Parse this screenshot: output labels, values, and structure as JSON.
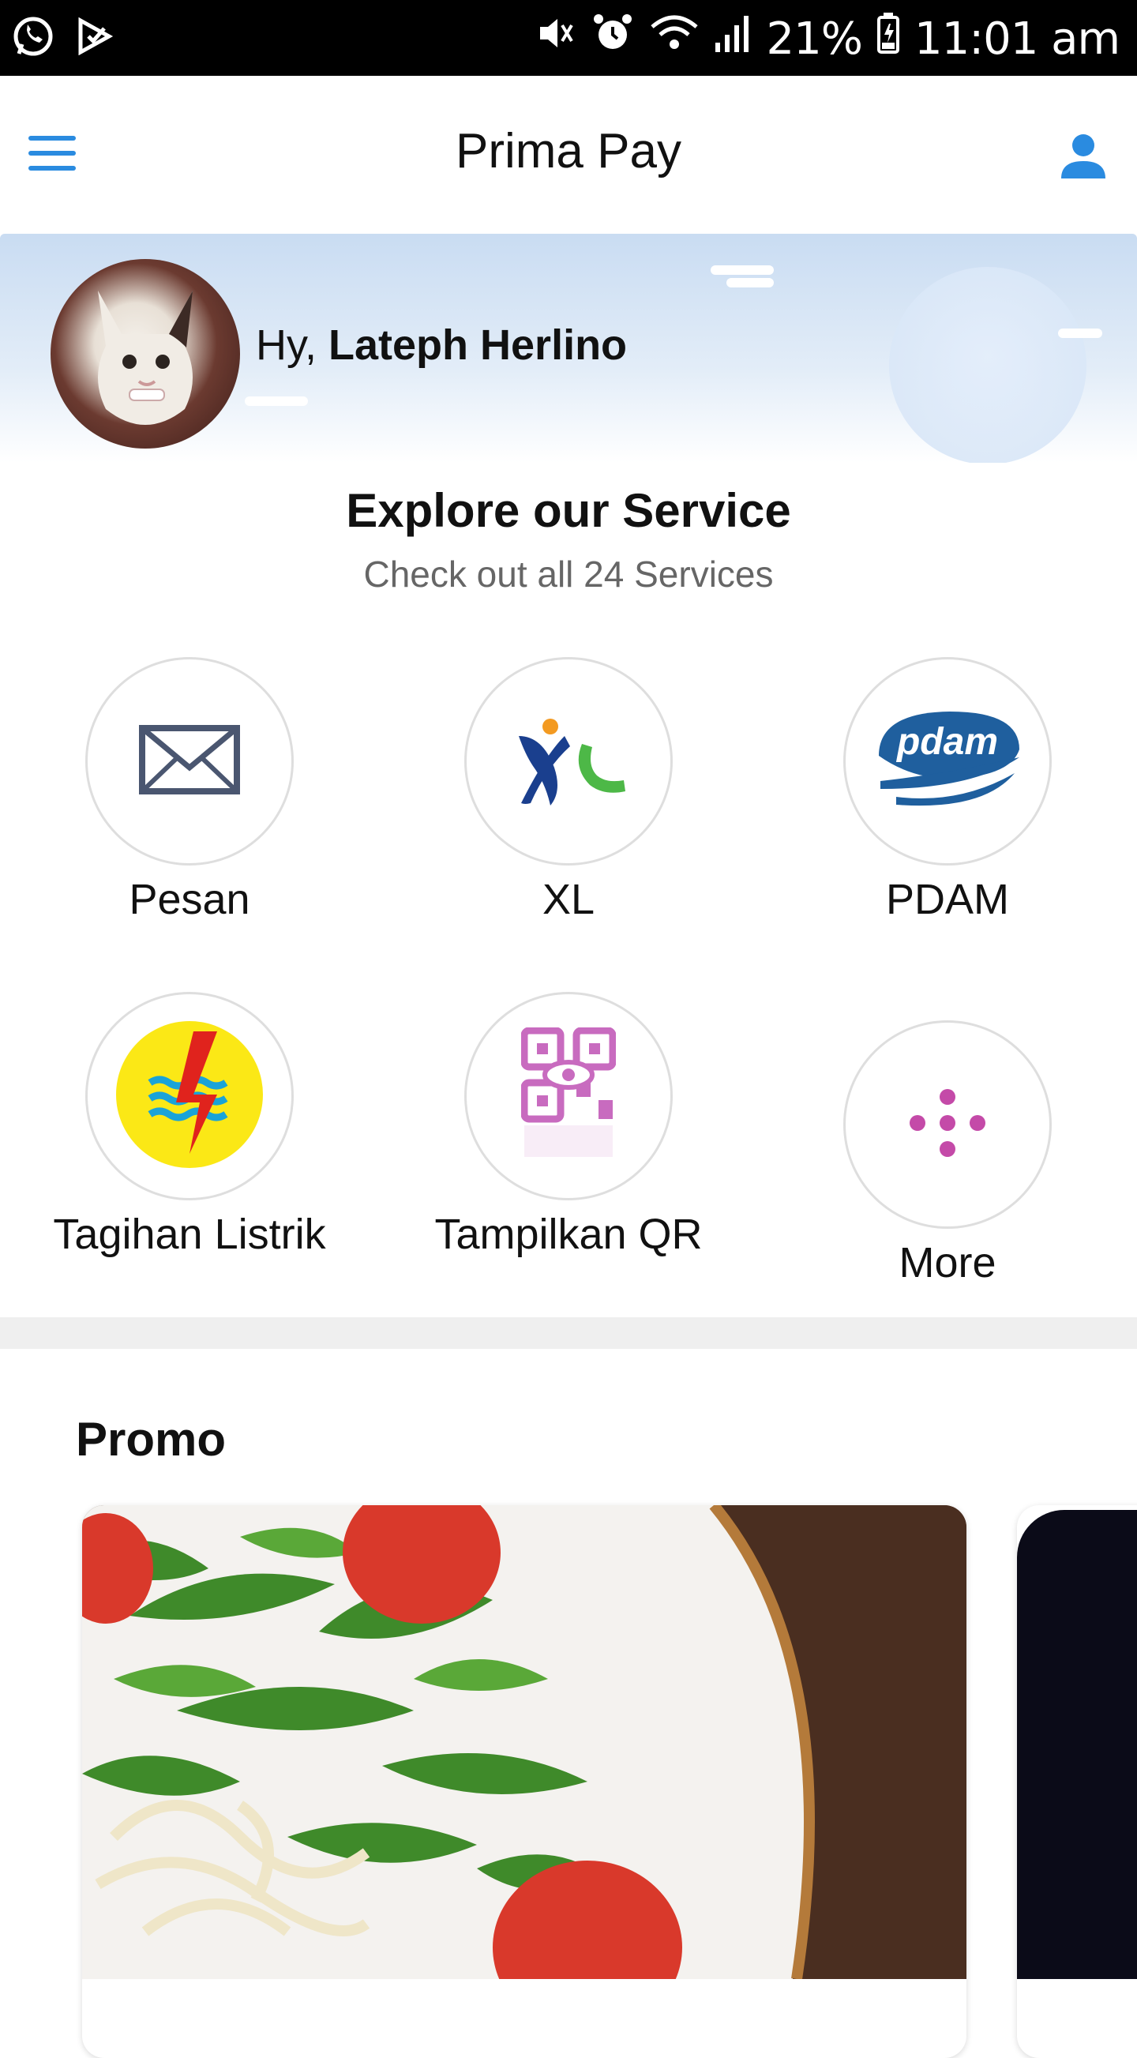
{
  "status_bar": {
    "battery": "21%",
    "time": "11:01 am"
  },
  "app_bar": {
    "title": "Prima Pay"
  },
  "greeting": {
    "prefix": "Hy,",
    "name": "Lateph Herlino"
  },
  "explore": {
    "title": "Explore our Service",
    "subtitle": "Check out all 24 Services"
  },
  "services": [
    {
      "label": "Pesan",
      "icon": "envelope-icon"
    },
    {
      "label": "XL",
      "icon": "xl-logo-icon"
    },
    {
      "label": "PDAM",
      "icon": "pdam-logo-icon"
    },
    {
      "label": "Tagihan Listrik",
      "icon": "pln-logo-icon"
    },
    {
      "label": "Tampilkan QR",
      "icon": "qr-code-icon"
    },
    {
      "label": "More",
      "icon": "more-dots-icon"
    }
  ],
  "promo": {
    "title": "Promo"
  },
  "colors": {
    "accent": "#2a8be0",
    "more_dots": "#c44aa8",
    "qr": "#c86bbf",
    "pln_yellow": "#fbe816",
    "pln_red": "#e0231d",
    "xl_blue": "#1a3f8e",
    "xl_green": "#4db847",
    "xl_orange": "#f39a21",
    "pdam_blue": "#1f5f9e"
  }
}
